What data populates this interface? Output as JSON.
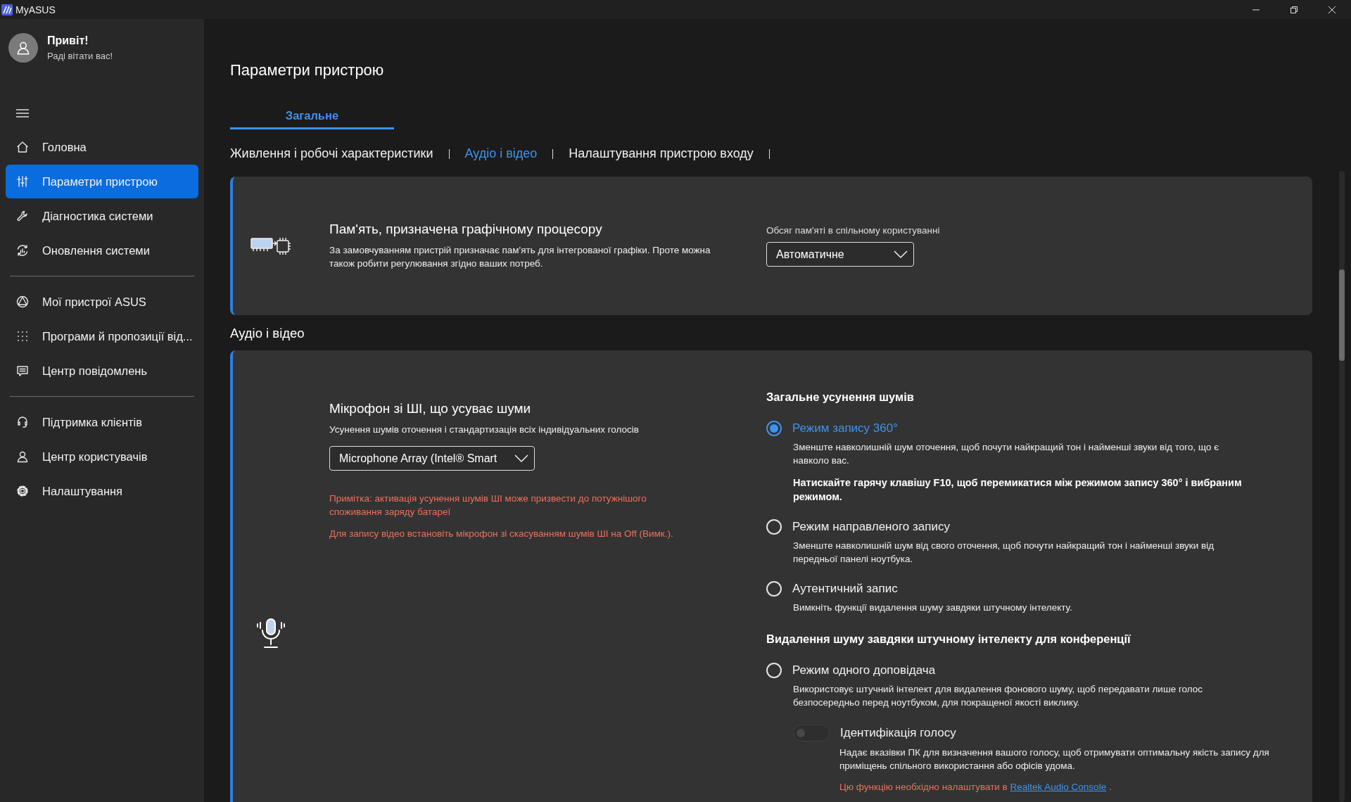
{
  "window": {
    "title": "MyASUS"
  },
  "user": {
    "greeting": "Привіт!",
    "subtitle": "Раді вітати вас!"
  },
  "sidebar": {
    "groups": [
      {
        "items": [
          {
            "label": "Головна",
            "selected": false
          },
          {
            "label": "Параметри пристрою",
            "selected": true
          },
          {
            "label": "Діагностика системи",
            "selected": false
          },
          {
            "label": "Оновлення системи",
            "selected": false
          }
        ]
      },
      {
        "items": [
          {
            "label": "Мої пристрої ASUS",
            "selected": false
          },
          {
            "label": "Програми й пропозиції від...",
            "selected": false
          },
          {
            "label": "Центр повідомлень",
            "selected": false
          }
        ]
      },
      {
        "items": [
          {
            "label": "Підтримка клієнтів",
            "selected": false
          },
          {
            "label": "Центр користувачів",
            "selected": false
          },
          {
            "label": "Налаштування",
            "selected": false
          }
        ]
      }
    ]
  },
  "page": {
    "title": "Параметри пристрою"
  },
  "tabs": [
    {
      "label": "Загальне",
      "selected": true
    }
  ],
  "subnav": [
    {
      "label": "Живлення і робочі характеристики",
      "selected": false
    },
    {
      "label": "Аудіо і відео",
      "selected": true
    },
    {
      "label": "Налаштування пристрою входу",
      "selected": false
    }
  ],
  "gpu_memory": {
    "title": "Пам'ять, призначена графічному процесору",
    "description": "За замовчуванням пристрій призначає пам'ять для інтегрованої графіки. Проте можна також робити регулювання згідно ваших потреб.",
    "field_label": "Обсяг пам'яті в спільному користуванні",
    "dropdown": {
      "value": "Автоматичне"
    }
  },
  "audio_section": {
    "title": "Аудіо і відео"
  },
  "ai_mic": {
    "title": "Мікрофон зі ШІ, що усуває шуми",
    "description": "Усунення шумів оточення і стандартизація всіх індивідуальних голосів",
    "dropdown": {
      "value": "Microphone Array (Intel® Smart"
    },
    "warnings": [
      "Примітка: активація усунення шумів ШІ може призвести до потужнішого споживання заряду батареї",
      "Для запису відео встановіть мікрофон зі скасуванням шумів ШІ на Off (Вимк.)."
    ]
  },
  "noise_groups": [
    {
      "heading": "Загальне усунення шумів",
      "options": [
        {
          "kind": "radio",
          "label": "Режим запису 360°",
          "selected": true,
          "description": "Зменште навколишній шум оточення, щоб почути найкращий тон і найменші звуки від того, що є навколо вас.",
          "note": "Натискайте гарячу клавішу F10, щоб перемикатися між режимом запису 360° і вибраним режимом."
        },
        {
          "kind": "radio",
          "label": "Режим направленого запису",
          "selected": false,
          "description": "Зменште навколишній шум від свого оточення, щоб почути найкращий тон і найменші звуки від передньої панелі ноутбука."
        },
        {
          "kind": "radio",
          "label": "Аутентичний запис",
          "selected": false,
          "description": "Вимкніть функції видалення шуму завдяки штучному інтелекту."
        }
      ]
    },
    {
      "heading": "Видалення шуму завдяки штучному інтелекту для конференції",
      "options": [
        {
          "kind": "radio",
          "label": "Режим одного доповідача",
          "selected": false,
          "description": "Використовує штучний інтелект для видалення фонового шуму, щоб передавати лише голос безпосередньо перед ноутбуком, для покращеної якості виклику."
        },
        {
          "kind": "toggle",
          "label": "Ідентифікація голосу",
          "on": false,
          "description": "Надає вказівки ПК для визначення вашого голосу, щоб отримувати оптимальну якість запису для приміщень спільного використання або офісів удома.",
          "setup_note": {
            "text": "Цю функцію необхідно налаштувати в",
            "link": "Realtek Audio Console",
            "suffix": "."
          }
        }
      ]
    }
  ]
}
